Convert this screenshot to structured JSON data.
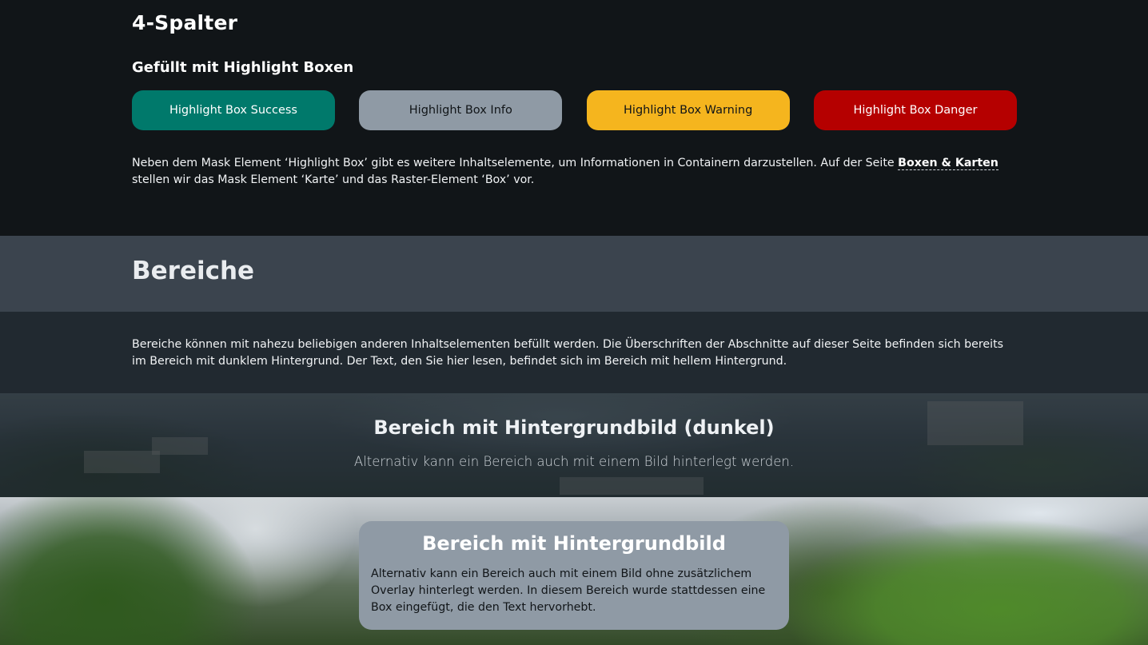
{
  "four_col": {
    "title": "4-Spalter",
    "subtitle": "Gefüllt mit Highlight Boxen",
    "boxes": [
      {
        "label": "Highlight Box Success",
        "color": "#00796b"
      },
      {
        "label": "Highlight Box Info",
        "color": "#8f9aa5"
      },
      {
        "label": "Highlight Box Warning",
        "color": "#f5b51e"
      },
      {
        "label": "Highlight Box Danger",
        "color": "#b50000"
      }
    ],
    "para_before": "Neben dem Mask Element ‘Highlight Box’ gibt es weitere Inhaltselemente, um Informationen in Containern darzustellen. Auf der Seite ",
    "link_text": "Boxen & Karten",
    "para_after": " stellen wir das Mask Element ‘Karte’ und das Raster-Element ‘Box’ vor."
  },
  "bereiche": {
    "title": "Bereiche",
    "text": "Bereiche können mit nahezu beliebigen anderen Inhaltselementen befüllt werden. Die Überschriften der Abschnitte auf dieser Seite befinden sich bereits im Bereich mit dunklem Hintergrund. Der Text, den Sie hier lesen, befindet sich im Bereich mit hellem Hintergrund."
  },
  "dark_image": {
    "title": "Bereich mit Hintergrundbild (dunkel)",
    "text": "Alternativ kann ein Bereich auch mit einem Bild hinterlegt werden."
  },
  "bright_image": {
    "title": "Bereich mit Hintergrundbild",
    "text": "Alternativ kann ein Bereich auch mit einem Bild ohne zusätzlichem Overlay hinterlegt werden. In diesem Bereich wurde stattdessen eine Box eingefügt, die den Text hervorhebt."
  },
  "colors": {
    "page_bg": "#111518",
    "section_head_bg": "#3b444e",
    "section_body_bg": "#212930"
  }
}
